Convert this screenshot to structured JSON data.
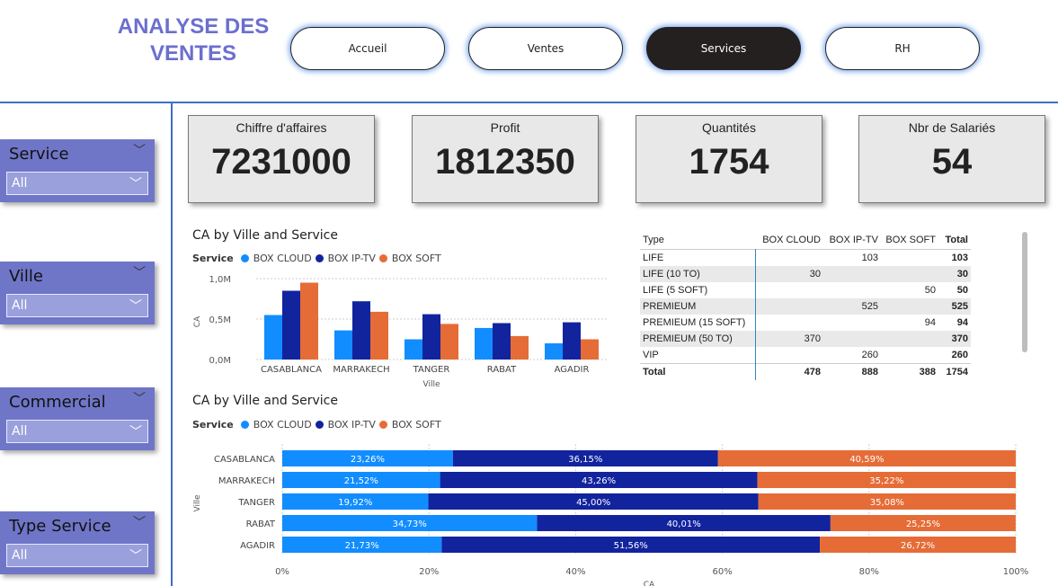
{
  "header": {
    "title_line1": "ANALYSE DES",
    "title_line2": "VENTES",
    "nav": [
      "Accueil",
      "Ventes",
      "Services",
      "RH"
    ],
    "active_nav": "Services"
  },
  "colors": {
    "box_cloud": "#118dff",
    "box_iptv": "#12239e",
    "box_soft": "#e66c37",
    "accent": "#3d6fc7"
  },
  "slicers": [
    {
      "label": "Service",
      "value": "All"
    },
    {
      "label": "Ville",
      "value": "All"
    },
    {
      "label": "Commercial",
      "value": "All"
    },
    {
      "label": "Type Service",
      "value": "All"
    }
  ],
  "kpis": [
    {
      "label": "Chiffre d'affaires",
      "value": "7231000"
    },
    {
      "label": "Profit",
      "value": "1812350"
    },
    {
      "label": "Quantités",
      "value": "1754"
    },
    {
      "label": "Nbr de Salariés",
      "value": "54"
    }
  ],
  "legend": {
    "title": "Service",
    "items": [
      "BOX CLOUD",
      "BOX IP-TV",
      "BOX SOFT"
    ]
  },
  "chart_data": [
    {
      "type": "bar",
      "title": "CA by Ville and Service",
      "xlabel": "Ville",
      "ylabel": "CA",
      "ylim": [
        0,
        1000000
      ],
      "yticks": [
        "0,0M",
        "0,5M",
        "1,0M"
      ],
      "categories": [
        "CASABLANCA",
        "MARRAKECH",
        "TANGER",
        "RABAT",
        "AGADIR"
      ],
      "series": [
        {
          "name": "BOX CLOUD",
          "values": [
            550000,
            360000,
            250000,
            390000,
            200000
          ]
        },
        {
          "name": "BOX IP-TV",
          "values": [
            850000,
            720000,
            560000,
            450000,
            460000
          ]
        },
        {
          "name": "BOX SOFT",
          "values": [
            950000,
            590000,
            440000,
            290000,
            250000
          ]
        }
      ]
    },
    {
      "type": "bar",
      "title": "CA by Ville and Service",
      "xlabel": "CA",
      "ylabel": "Ville",
      "xticks": [
        "0%",
        "20%",
        "40%",
        "60%",
        "80%",
        "100%"
      ],
      "categories": [
        "CASABLANCA",
        "MARRAKECH",
        "TANGER",
        "RABAT",
        "AGADIR"
      ],
      "series": [
        {
          "name": "BOX CLOUD",
          "values": [
            23.26,
            21.52,
            19.92,
            34.73,
            21.73
          ],
          "labels": [
            "23,26%",
            "21,52%",
            "19,92%",
            "34,73%",
            "21,73%"
          ]
        },
        {
          "name": "BOX IP-TV",
          "values": [
            36.15,
            43.26,
            45.0,
            40.01,
            51.56
          ],
          "labels": [
            "36,15%",
            "43,26%",
            "45,00%",
            "40,01%",
            "51,56%"
          ]
        },
        {
          "name": "BOX SOFT",
          "values": [
            40.59,
            35.22,
            35.08,
            25.25,
            26.72
          ],
          "labels": [
            "40,59%",
            "35,22%",
            "35,08%",
            "25,25%",
            "26,72%"
          ]
        }
      ]
    }
  ],
  "matrix": {
    "headers": [
      "Type",
      "BOX CLOUD",
      "BOX IP-TV",
      "BOX SOFT",
      "Total"
    ],
    "rows": [
      [
        "LIFE",
        "",
        "103",
        "",
        "103"
      ],
      [
        "LIFE (10 TO)",
        "30",
        "",
        "",
        "30"
      ],
      [
        "LIFE (5 SOFT)",
        "",
        "",
        "50",
        "50"
      ],
      [
        "PREMIEUM",
        "",
        "525",
        "",
        "525"
      ],
      [
        "PREMIEUM (15 SOFT)",
        "",
        "",
        "94",
        "94"
      ],
      [
        "PREMIEUM (50 TO)",
        "370",
        "",
        "",
        "370"
      ],
      [
        "VIP",
        "",
        "260",
        "",
        "260"
      ]
    ],
    "total": [
      "Total",
      "478",
      "888",
      "388",
      "1754"
    ]
  }
}
